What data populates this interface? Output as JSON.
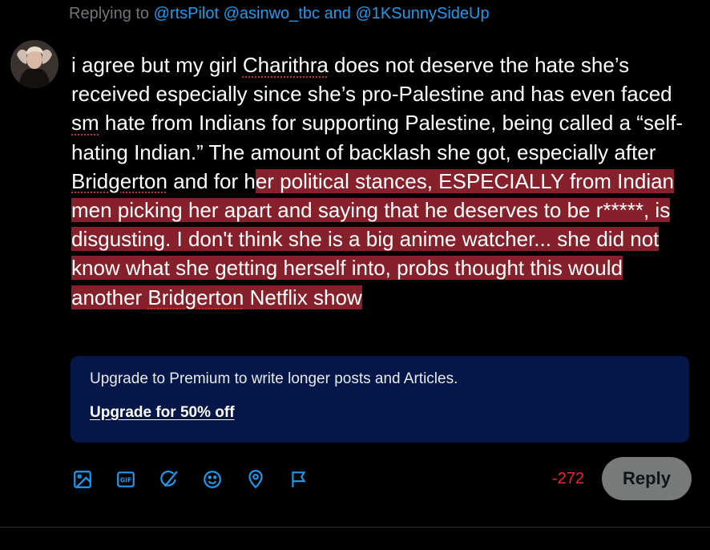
{
  "reply_context": {
    "prefix": "Replying to",
    "handles": [
      "@rtsPilot",
      "@asinwo_tbc"
    ],
    "and_text": "and",
    "last_handle": "@1KSunnySideUp"
  },
  "compose": {
    "text_plain_1": "i agree but my girl ",
    "word_charithra": "Charithra",
    "text_plain_2": " does not deserve the hate she’s received especially since she’s pro-Palestine and has even faced ",
    "word_sm": "sm",
    "text_plain_3": " hate from Indians for supporting Palestine, being called a “self-hating Indian.” The amount of backlash she got, especially after ",
    "word_bridgerton_1": "Bridgerton",
    "text_plain_4": " and for h",
    "text_over_1": "er political stances, ESPECIALLY from Indian men picking her apart and saying that he deserves to be r*****, is disgusting. I don't think she is a big anime watcher... she did not know what she getting herself into, probs thought this would another ",
    "word_bridgerton_2": "Bridgerton",
    "text_over_2": " Netflix show"
  },
  "premium_banner": {
    "message": "Upgrade to Premium to write longer posts and Articles.",
    "cta": "Upgrade for 50% off"
  },
  "toolbar": {
    "icons": [
      "image-icon",
      "gif-icon",
      "grok-icon",
      "emoji-icon",
      "location-icon",
      "flag-icon"
    ],
    "gif_text": "GIF"
  },
  "char_counter": "-272",
  "reply_button": "Reply",
  "colors": {
    "accent": "#1d9bf0",
    "overflow_highlight": "#86202a",
    "premium_bg": "#051748",
    "counter_negative": "#f4212e"
  }
}
